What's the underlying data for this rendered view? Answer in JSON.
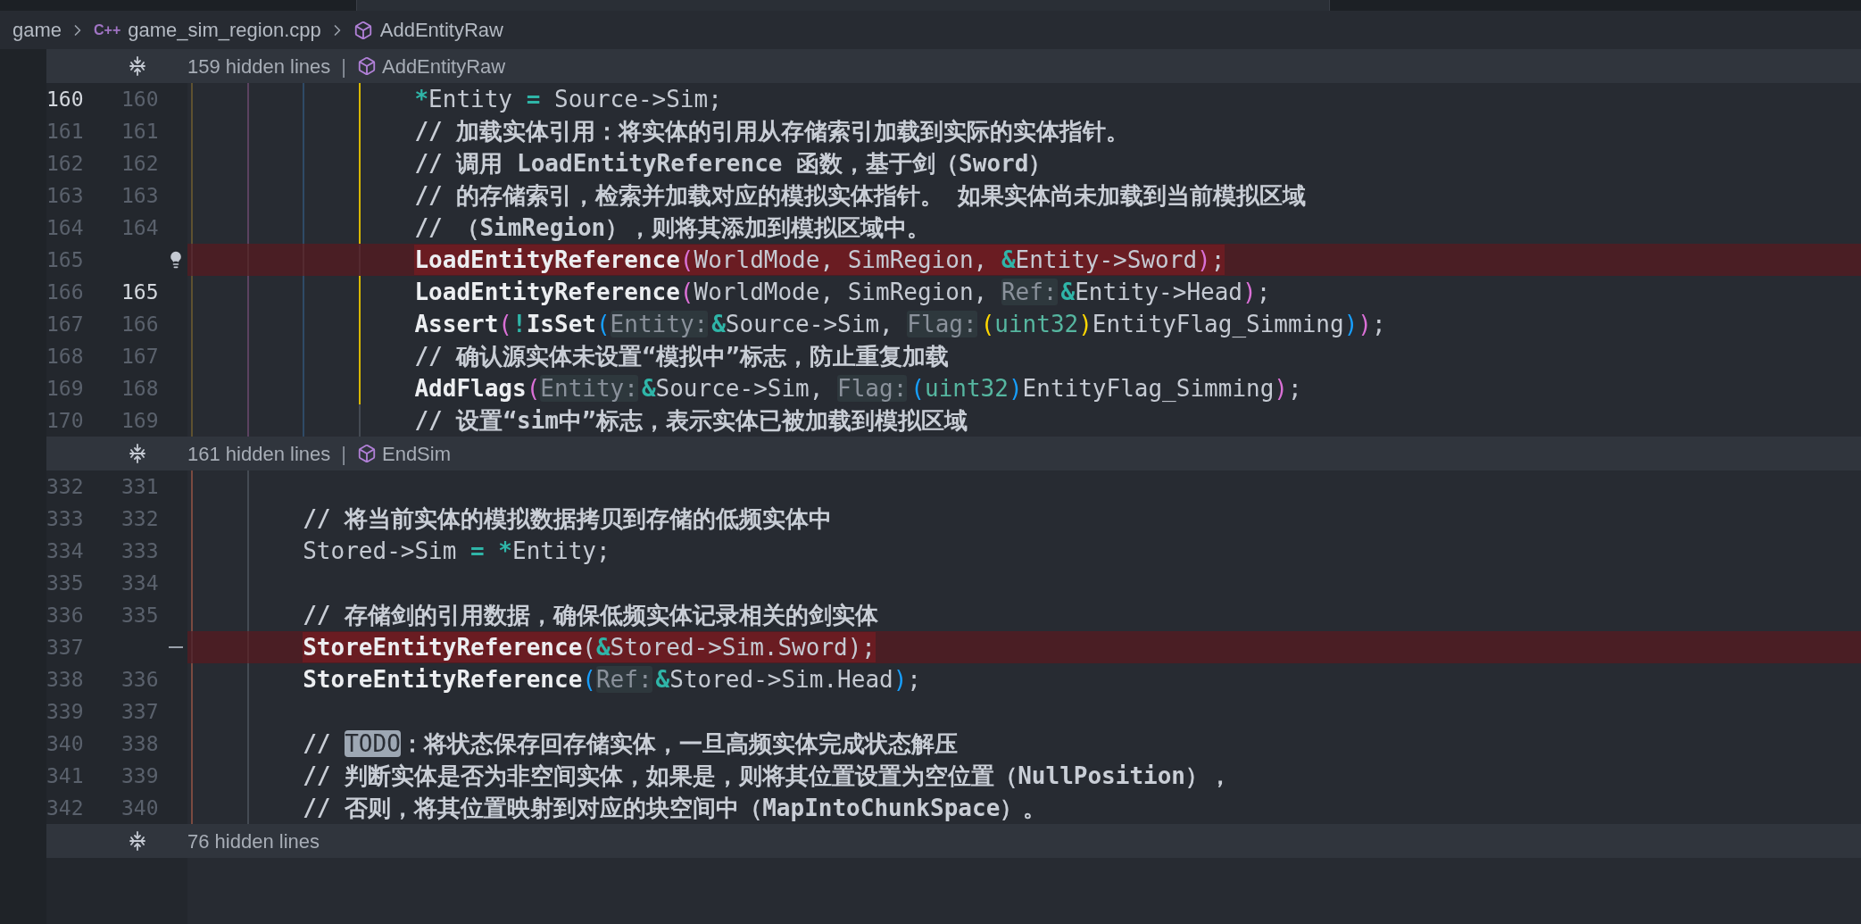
{
  "breadcrumb": [
    {
      "kind": "folder",
      "label": "game"
    },
    {
      "kind": "file",
      "badge": "C++",
      "label": "game_sim_region.cpp"
    },
    {
      "kind": "symbol",
      "label": "AddEntityRaw"
    }
  ],
  "blocks": [
    {
      "kind": "fold",
      "hidden": "159 hidden lines",
      "separator": "|",
      "symbol": "AddEntityRaw"
    },
    {
      "kind": "lines",
      "lines": [
        {
          "old": "160",
          "new": "160",
          "old_active": true,
          "new_active": false,
          "kind": "normal",
          "guides": [
            {
              "color": "#5e5130"
            },
            {
              "color": "#5b4260"
            },
            {
              "color": "#2f4a66"
            },
            {
              "color": "#d9b800"
            }
          ],
          "tokens": [
            {
              "kind": "op",
              "t": "*"
            },
            {
              "kind": "id",
              "t": "Entity "
            },
            {
              "kind": "op",
              "t": "="
            },
            {
              "kind": "id",
              "t": " Source->Sim;"
            }
          ]
        },
        {
          "old": "161",
          "new": "161",
          "old_active": false,
          "new_active": false,
          "kind": "normal",
          "guides": [
            {
              "color": "#5e5130"
            },
            {
              "color": "#5b4260"
            },
            {
              "color": "#2f4a66"
            },
            {
              "color": "#d9b800"
            }
          ],
          "tokens": [
            {
              "kind": "cm",
              "t": "// 加载实体引用：将实体的引用从存储索引加载到实际的实体指针。"
            }
          ]
        },
        {
          "old": "162",
          "new": "162",
          "old_active": false,
          "new_active": false,
          "kind": "normal",
          "guides": [
            {
              "color": "#5e5130"
            },
            {
              "color": "#5b4260"
            },
            {
              "color": "#2f4a66"
            },
            {
              "color": "#d9b800"
            }
          ],
          "tokens": [
            {
              "kind": "cm",
              "t": "// 调用 LoadEntityReference 函数，基于剑（Sword）"
            }
          ]
        },
        {
          "old": "163",
          "new": "163",
          "old_active": false,
          "new_active": false,
          "kind": "normal",
          "guides": [
            {
              "color": "#5e5130"
            },
            {
              "color": "#5b4260"
            },
            {
              "color": "#2f4a66"
            },
            {
              "color": "#d9b800"
            }
          ],
          "tokens": [
            {
              "kind": "cm",
              "t": "// 的存储索引，检索并加载对应的模拟实体指针。 如果实体尚未加载到当前模拟区域"
            }
          ]
        },
        {
          "old": "164",
          "new": "164",
          "old_active": false,
          "new_active": false,
          "kind": "normal",
          "guides": [
            {
              "color": "#5e5130"
            },
            {
              "color": "#5b4260"
            },
            {
              "color": "#2f4a66"
            },
            {
              "color": "#d9b800"
            }
          ],
          "tokens": [
            {
              "kind": "cm",
              "t": "// （SimRegion），则将其添加到模拟区域中。"
            }
          ]
        },
        {
          "old": "165",
          "old_active": false,
          "kind": "deleted",
          "gutter": {
            "kind": "bulb"
          },
          "guides": [
            {
              "color": "#552a30"
            },
            {
              "color": "#552a30"
            },
            {
              "color": "#552a30"
            },
            {
              "color": "#552a30"
            }
          ],
          "tokens": [
            {
              "kind": "fn",
              "t": "LoadEntityReference"
            },
            {
              "kind": "p1",
              "t": "("
            },
            {
              "kind": "id",
              "t": "WorldMode, SimRegion, "
            },
            {
              "kind": "op",
              "t": "&"
            },
            {
              "kind": "id",
              "t": "Entity->Sword"
            },
            {
              "kind": "p1",
              "t": ")"
            },
            {
              "kind": "id",
              "t": ";"
            }
          ]
        },
        {
          "old": "166",
          "new": "165",
          "old_active": false,
          "new_active": true,
          "kind": "normal",
          "guides": [
            {
              "color": "#5e5130"
            },
            {
              "color": "#5b4260"
            },
            {
              "color": "#2f4a66"
            },
            {
              "color": "#d9b800"
            }
          ],
          "tokens": [
            {
              "kind": "fn",
              "t": "LoadEntityReference"
            },
            {
              "kind": "p1",
              "t": "("
            },
            {
              "kind": "id",
              "t": "WorldMode, SimRegion, "
            },
            {
              "kind": "hint",
              "t": "Ref:"
            },
            {
              "kind": "op",
              "t": "&"
            },
            {
              "kind": "id",
              "t": "Entity->Head"
            },
            {
              "kind": "p1",
              "t": ")"
            },
            {
              "kind": "id",
              "t": ";"
            }
          ]
        },
        {
          "old": "167",
          "new": "166",
          "old_active": false,
          "new_active": false,
          "kind": "normal",
          "guides": [
            {
              "color": "#5e5130"
            },
            {
              "color": "#5b4260"
            },
            {
              "color": "#2f4a66"
            },
            {
              "color": "#d9b800"
            }
          ],
          "tokens": [
            {
              "kind": "fn",
              "t": "Assert"
            },
            {
              "kind": "p1",
              "t": "("
            },
            {
              "kind": "op",
              "t": "!"
            },
            {
              "kind": "fn",
              "t": "IsSet"
            },
            {
              "kind": "p2",
              "t": "("
            },
            {
              "kind": "hint",
              "t": "Entity:"
            },
            {
              "kind": "op",
              "t": "&"
            },
            {
              "kind": "id",
              "t": "Source->Sim, "
            },
            {
              "kind": "hint",
              "t": "Flag:"
            },
            {
              "kind": "p3",
              "t": "("
            },
            {
              "kind": "ty",
              "t": "uint32"
            },
            {
              "kind": "p3",
              "t": ")"
            },
            {
              "kind": "id",
              "t": "EntityFlag_Simming"
            },
            {
              "kind": "p2",
              "t": ")"
            },
            {
              "kind": "p1",
              "t": ")"
            },
            {
              "kind": "id",
              "t": ";"
            }
          ]
        },
        {
          "old": "168",
          "new": "167",
          "old_active": false,
          "new_active": false,
          "kind": "normal",
          "guides": [
            {
              "color": "#5e5130"
            },
            {
              "color": "#5b4260"
            },
            {
              "color": "#2f4a66"
            },
            {
              "color": "#d9b800"
            }
          ],
          "tokens": [
            {
              "kind": "cm",
              "t": "// 确认源实体未设置“模拟中”标志，防止重复加载"
            }
          ]
        },
        {
          "old": "169",
          "new": "168",
          "old_active": false,
          "new_active": false,
          "kind": "normal",
          "guides": [
            {
              "color": "#5e5130"
            },
            {
              "color": "#5b4260"
            },
            {
              "color": "#2f4a66"
            },
            {
              "color": "#d9b800"
            }
          ],
          "tokens": [
            {
              "kind": "fn",
              "t": "AddFlags"
            },
            {
              "kind": "p1",
              "t": "("
            },
            {
              "kind": "hint",
              "t": "Entity:"
            },
            {
              "kind": "op",
              "t": "&"
            },
            {
              "kind": "id",
              "t": "Source->Sim, "
            },
            {
              "kind": "hint",
              "t": "Flag:"
            },
            {
              "kind": "p2",
              "t": "("
            },
            {
              "kind": "ty",
              "t": "uint32"
            },
            {
              "kind": "p2",
              "t": ")"
            },
            {
              "kind": "id",
              "t": "EntityFlag_Simming"
            },
            {
              "kind": "p1",
              "t": ")"
            },
            {
              "kind": "id",
              "t": ";"
            }
          ]
        },
        {
          "old": "170",
          "new": "169",
          "old_active": false,
          "new_active": false,
          "kind": "normal",
          "guides": [
            {
              "color": "#5e5130"
            },
            {
              "color": "#5b4260"
            },
            {
              "color": "#2f4a66"
            },
            {
              "color": "#444a53"
            }
          ],
          "tokens": [
            {
              "kind": "cm",
              "t": "// 设置“sim中”标志，表示实体已被加载到模拟区域"
            }
          ]
        }
      ]
    },
    {
      "kind": "fold",
      "hidden": "161 hidden lines",
      "separator": "|",
      "symbol": "EndSim"
    },
    {
      "kind": "lines",
      "lines": [
        {
          "old": "332",
          "new": "331",
          "old_active": false,
          "new_active": false,
          "kind": "normal",
          "guides": [
            {
              "color": "#7a4a40"
            },
            {
              "color": "#444a53"
            }
          ]
        },
        {
          "old": "333",
          "new": "332",
          "old_active": false,
          "new_active": false,
          "kind": "normal",
          "guides": [
            {
              "color": "#7a4a40"
            },
            {
              "color": "#444a53"
            }
          ],
          "tokens": [
            {
              "kind": "cm",
              "t": "// 将当前实体的模拟数据拷贝到存储的低频实体中"
            }
          ]
        },
        {
          "old": "334",
          "new": "333",
          "old_active": false,
          "new_active": false,
          "kind": "normal",
          "guides": [
            {
              "color": "#7a4a40"
            },
            {
              "color": "#444a53"
            }
          ],
          "tokens": [
            {
              "kind": "id",
              "t": "Stored->Sim "
            },
            {
              "kind": "op",
              "t": "="
            },
            {
              "kind": "op",
              "t": " *"
            },
            {
              "kind": "id",
              "t": "Entity;"
            }
          ]
        },
        {
          "old": "335",
          "new": "334",
          "old_active": false,
          "new_active": false,
          "kind": "normal",
          "guides": [
            {
              "color": "#7a4a40"
            },
            {
              "color": "#444a53"
            }
          ]
        },
        {
          "old": "336",
          "new": "335",
          "old_active": false,
          "new_active": false,
          "kind": "normal",
          "guides": [
            {
              "color": "#7a4a40"
            },
            {
              "color": "#444a53"
            }
          ],
          "tokens": [
            {
              "kind": "cm",
              "t": "// 存储剑的引用数据，确保低频实体记录相关的剑实体"
            }
          ]
        },
        {
          "old": "337",
          "old_active": false,
          "kind": "deleted",
          "gutter": {
            "kind": "minus"
          },
          "guides": [
            {
              "color": "#552a30"
            },
            {
              "color": "#552a30"
            }
          ],
          "tokens": [
            {
              "kind": "fn",
              "t": "StoreEntityReference"
            },
            {
              "kind": "id",
              "t": "("
            },
            {
              "kind": "op",
              "t": "&"
            },
            {
              "kind": "id",
              "t": "Stored->Sim.Sword);"
            }
          ]
        },
        {
          "old": "338",
          "new": "336",
          "old_active": false,
          "new_active": false,
          "kind": "normal",
          "guides": [
            {
              "color": "#7a4a40"
            },
            {
              "color": "#444a53"
            }
          ],
          "tokens": [
            {
              "kind": "fn",
              "t": "StoreEntityReference"
            },
            {
              "kind": "p2",
              "t": "("
            },
            {
              "kind": "hint",
              "t": "Ref:"
            },
            {
              "kind": "op",
              "t": "&"
            },
            {
              "kind": "id",
              "t": "Stored->Sim.Head"
            },
            {
              "kind": "p2",
              "t": ")"
            },
            {
              "kind": "id",
              "t": ";"
            }
          ]
        },
        {
          "old": "339",
          "new": "337",
          "old_active": false,
          "new_active": false,
          "kind": "normal",
          "guides": [
            {
              "color": "#7a4a40"
            },
            {
              "color": "#444a53"
            }
          ]
        },
        {
          "old": "340",
          "new": "338",
          "old_active": false,
          "new_active": false,
          "kind": "normal",
          "guides": [
            {
              "color": "#7a4a40"
            },
            {
              "color": "#444a53"
            }
          ],
          "tokens": [
            {
              "kind": "cm",
              "t": "// "
            },
            {
              "kind": "todo",
              "t": "TODO"
            },
            {
              "kind": "cm",
              "t": "：将状态保存回存储实体，一旦高频实体完成状态解压"
            }
          ]
        },
        {
          "old": "341",
          "new": "339",
          "old_active": false,
          "new_active": false,
          "kind": "normal",
          "guides": [
            {
              "color": "#7a4a40"
            },
            {
              "color": "#444a53"
            }
          ],
          "tokens": [
            {
              "kind": "cm",
              "t": "// 判断实体是否为非空间实体，如果是，则将其位置设置为空位置（NullPosition），"
            }
          ]
        },
        {
          "old": "342",
          "new": "340",
          "old_active": false,
          "new_active": false,
          "kind": "normal",
          "guides": [
            {
              "color": "#7a4a40"
            },
            {
              "color": "#444a53"
            }
          ],
          "tokens": [
            {
              "kind": "cm",
              "t": "// 否则，将其位置映射到对应的块空间中（MapIntoChunkSpace）。"
            }
          ]
        }
      ]
    },
    {
      "kind": "fold",
      "hidden": "76 hidden lines"
    }
  ]
}
